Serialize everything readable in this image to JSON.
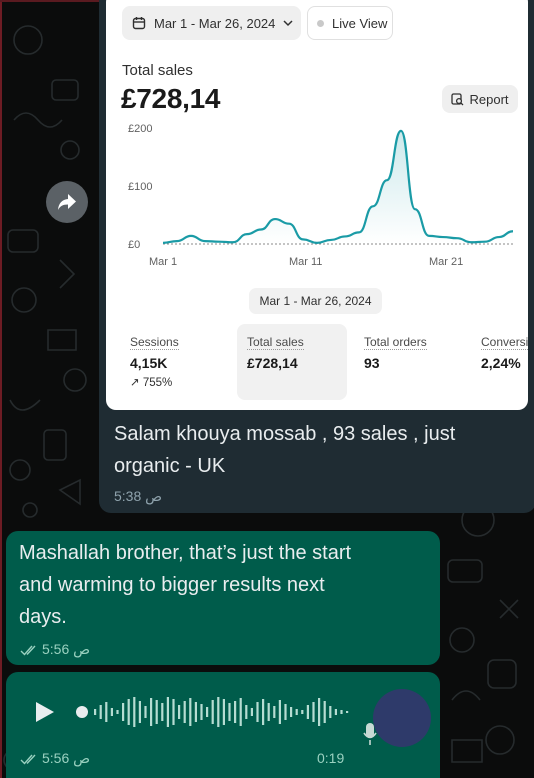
{
  "shared_screenshot": {
    "date_range": "Mar 1 - Mar 26, 2024",
    "live_view": "Live View",
    "total_sales_label": "Total sales",
    "total_sales_value": "£728,14",
    "report_label": "Report",
    "range_chip": "Mar 1 - Mar 26, 2024",
    "cards": [
      {
        "label": "Sessions",
        "value": "4,15K",
        "delta": "↗ 755%"
      },
      {
        "label": "Total sales",
        "value": "£728,14"
      },
      {
        "label": "Total orders",
        "value": "93"
      },
      {
        "label": "Conversi",
        "value": "2,24%"
      }
    ]
  },
  "chart_data": {
    "type": "line",
    "y_ticks": [
      "£200",
      "£100",
      "£0"
    ],
    "x_ticks": [
      "Mar 1",
      "Mar 11",
      "Mar 21"
    ],
    "ylim": [
      0,
      200
    ],
    "color": "#1a9ba6",
    "series": [
      {
        "x": [
          1,
          2,
          3,
          4,
          5,
          6,
          7,
          8,
          9,
          10,
          11,
          12,
          13,
          14,
          15,
          16,
          17,
          18,
          19,
          20,
          21,
          22,
          23,
          24,
          25,
          26
        ],
        "values": [
          2,
          5,
          14,
          5,
          4,
          3,
          17,
          25,
          43,
          35,
          8,
          2,
          7,
          13,
          20,
          65,
          110,
          195,
          60,
          14,
          12,
          10,
          3,
          4,
          12,
          22
        ]
      }
    ]
  },
  "messages": {
    "incoming": {
      "text_line1": "Salam khouya mossab , 93 sales , just",
      "text_line2": "organic - UK",
      "time": "5:38 ص"
    },
    "outgoing_text": {
      "line1": "Mashallah brother, that’s just the start",
      "line2": "and warming to bigger results next",
      "line3": "days.",
      "time": "5:56 ص"
    },
    "outgoing_voice": {
      "duration": "0:19",
      "time": "5:56 ص"
    }
  },
  "colors": {
    "chat_bg": "#0b0c0c",
    "incoming_bubble": "#1f2c33",
    "outgoing_bubble": "#005c4b",
    "chart_line": "#1a9ba6"
  },
  "icons": [
    "calendar-icon",
    "live-dot-icon",
    "report-icon",
    "forward-icon",
    "play-icon",
    "microphone-icon",
    "double-check-icon"
  ]
}
